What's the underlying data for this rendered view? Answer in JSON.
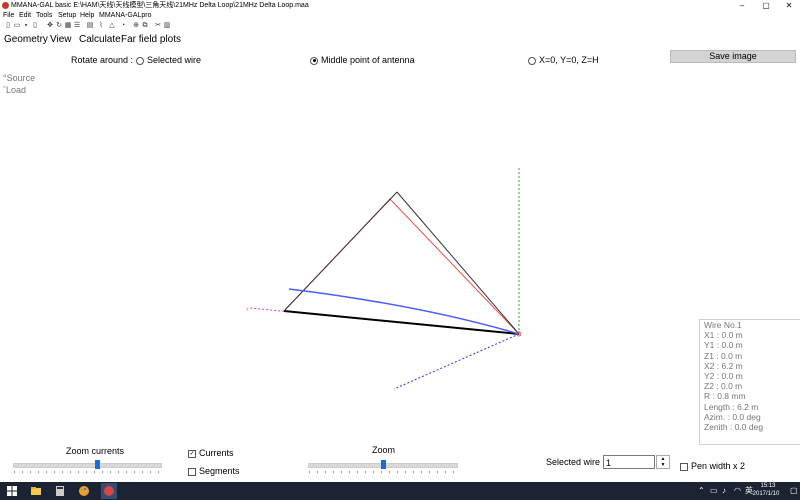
{
  "window": {
    "title": "MMANA-GAL basic E:\\HAM\\天线\\天线模型\\三角天线\\21MHz Delta Loop\\21MHz Delta Loop.maa",
    "min_label": "–",
    "max_label": "▢",
    "close_label": "✕"
  },
  "menu": {
    "file": "File",
    "edit": "Edit",
    "tools": "Tools",
    "setup": "Setup",
    "help": "Help",
    "mmana": "MMANA-GALpro"
  },
  "toolbar_icons": [
    "new-icon",
    "open-icon",
    "save-icon",
    "copy-icon",
    "move-icon",
    "rotate-icon",
    "grid-icon",
    "table-icon",
    "doc-icon",
    "plot-icon",
    "triangle-icon",
    "polar-icon",
    "target-icon",
    "copy2-icon",
    "tools-icon",
    "calc-icon"
  ],
  "tabs": {
    "geometry": "Geometry",
    "view": "View",
    "calculate": "Calculate",
    "farfield": "Far field plots"
  },
  "rotate": {
    "label": "Rotate around :",
    "opt1": "Selected wire",
    "opt2": "Middle point of antenna",
    "opt3": "X=0, Y=0, Z=H",
    "selected": "opt2"
  },
  "save_image": "Save image",
  "legend": {
    "source": "Source",
    "load": "Load"
  },
  "wire_info": {
    "header": "Wire No.1",
    "rows": [
      "X1   :   0.0 m",
      "Y1   :   0.0 m",
      "Z1   :   0.0 m",
      "X2   :   6.2 m",
      "Y2   :   0.0 m",
      "Z2   :   0.0 m",
      "R     :   0.8 mm",
      "Length  : 6.2 m",
      "Azim.   :  0.0 deg",
      "Zenith  :  0.0 deg"
    ]
  },
  "bottom": {
    "zoom_currents": "Zoom currents",
    "zoom_currents_level": 0.57,
    "currents": "Currents",
    "currents_checked": true,
    "segments": "Segments",
    "segments_checked": false,
    "zoom": "Zoom",
    "zoom_level": 0.5,
    "selected_wire_label": "Selected wire",
    "selected_wire_value": "1",
    "pen_width": "Pen width x 2",
    "pen_checked": false
  },
  "taskbar": {
    "time": "15:13",
    "date": "2017/1/10",
    "ime": "英"
  },
  "colors": {
    "wire_black": "#000000",
    "wire_red": "#e8504f",
    "current_blue": "#4a5ff0",
    "axis_green": "#2ca02c",
    "axis_magenta": "#d040d0",
    "axis_blue": "#3030e0",
    "accent": "#1e6bd6"
  }
}
